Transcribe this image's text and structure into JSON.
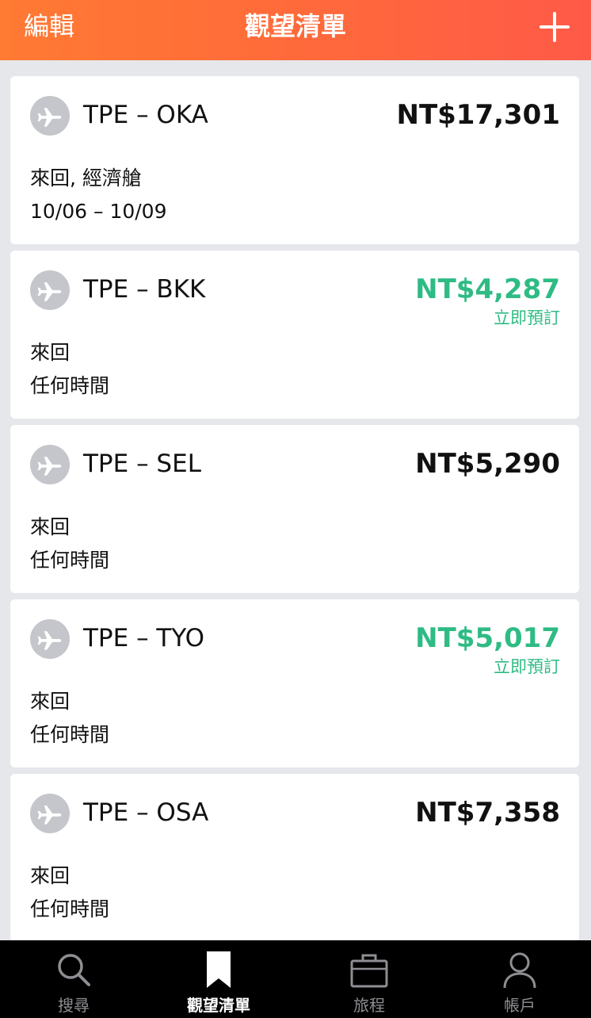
{
  "header": {
    "edit_label": "編輯",
    "title": "觀望清單",
    "add_icon": "plus-icon"
  },
  "colors": {
    "header_gradient_start": "#ff7a33",
    "header_gradient_end": "#ff5a48",
    "deal_green": "#2fbb84",
    "tab_bar": "#000000"
  },
  "watchlist": [
    {
      "route": "TPE – OKA",
      "price": "NT$17,301",
      "deal": false,
      "book_label": "",
      "line1": "來回, 經濟艙",
      "line2": "10/06 – 10/09"
    },
    {
      "route": "TPE – BKK",
      "price": "NT$4,287",
      "deal": true,
      "book_label": "立即預訂",
      "line1": "來回",
      "line2": "任何時間"
    },
    {
      "route": "TPE – SEL",
      "price": "NT$5,290",
      "deal": false,
      "book_label": "",
      "line1": "來回",
      "line2": "任何時間"
    },
    {
      "route": "TPE – TYO",
      "price": "NT$5,017",
      "deal": true,
      "book_label": "立即預訂",
      "line1": "來回",
      "line2": "任何時間"
    },
    {
      "route": "TPE – OSA",
      "price": "NT$7,358",
      "deal": false,
      "book_label": "",
      "line1": "來回",
      "line2": "任何時間"
    }
  ],
  "tabs": [
    {
      "label": "搜尋",
      "icon": "search-icon",
      "active": false
    },
    {
      "label": "觀望清單",
      "icon": "bookmark-icon",
      "active": true
    },
    {
      "label": "旅程",
      "icon": "briefcase-icon",
      "active": false
    },
    {
      "label": "帳戶",
      "icon": "person-icon",
      "active": false
    }
  ]
}
